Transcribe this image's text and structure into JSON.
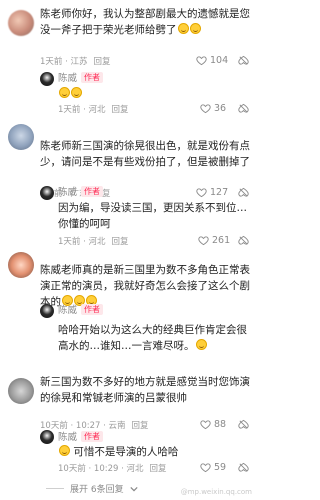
{
  "comments": [
    {
      "text": "陈老师你好，我认为整部剧最大的遗憾就是您没一斧子把于荣光老师给劈了",
      "time": "1天前 · 江苏",
      "reply_label": "回复",
      "likes": "104"
    },
    {
      "reply": true,
      "user": "陈威",
      "badge": "作者",
      "time": "1天前 · 河北",
      "reply_label": "回复",
      "likes": "36"
    },
    {
      "text": "陈老师新三国演的徐晃很出色，就是戏份有点少，请问是不是有些戏份拍了，但是被删掉了",
      "time": "1天前 · 广东",
      "reply_label": "回复",
      "likes": "127"
    },
    {
      "reply": true,
      "user": "陈威",
      "badge": "作者",
      "text": "因为编，导没读三国，更因关系不到位…你懂的呵呵",
      "time": "1天前 · 河北",
      "reply_label": "回复",
      "likes": "261"
    },
    {
      "text": "陈威老师真的是新三国里为数不多角色正常表演正常的演员，我就好奇怎么会接了这么个剧本的",
      "time": "",
      "reply_label": "",
      "likes": ""
    },
    {
      "reply": true,
      "user": "陈威",
      "badge": "作者",
      "text": "哈哈开始以为这么大的经典巨作肯定会很高水的…谁知…一言难尽呀。",
      "time": "",
      "reply_label": "",
      "likes": ""
    },
    {
      "text": "新三国为数不多好的地方就是感觉当时您饰演的徐晃和常铖老师演的吕蒙很帅",
      "time": "10天前 · 10:27 · 云南",
      "reply_label": "回复",
      "likes": "88"
    },
    {
      "reply": true,
      "user": "陈威",
      "badge": "作者",
      "text": "可惜不是导演的人哈哈",
      "time": "10天前 · 10:29 · 河北",
      "reply_label": "回复",
      "likes": "59"
    }
  ],
  "expand": {
    "label": "展开 6条回复",
    "chevron": "chevron-down-icon"
  },
  "watermark": "@mp.weixin.qq.com",
  "colors": {
    "badge_bg": "#fde7ea",
    "badge_text": "#fe2c55",
    "meta": "#9a9a9a"
  }
}
